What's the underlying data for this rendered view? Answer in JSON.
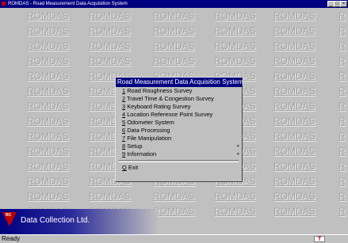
{
  "window": {
    "title": "ROMDAS - Road Measurement Data Acquisition System"
  },
  "watermark": {
    "text": "ROMDAS",
    "edge_text": "R"
  },
  "menu": {
    "title": "Road Measurement Data Acquisition System",
    "items": [
      {
        "key": "1",
        "label": "Road Roughness Survey"
      },
      {
        "key": "2",
        "label": "Travel Time & Congestion Survey"
      },
      {
        "key": "3",
        "label": "Keyboard Rating Survey"
      },
      {
        "key": "4",
        "label": "Location Reference Point Survey"
      },
      {
        "key": "5",
        "label": "Odometer System"
      },
      {
        "key": "6",
        "label": "Data Processing"
      },
      {
        "key": "7",
        "label": "File Manipulation"
      },
      {
        "key": "8",
        "label": "Setup",
        "submenu": "»"
      },
      {
        "key": "9",
        "label": "Information",
        "submenu": "»"
      }
    ],
    "exit": {
      "key": "Q",
      "label": "Exit"
    }
  },
  "logo": {
    "badge": "RC",
    "text": "Data Collection Ltd."
  },
  "status": {
    "text": "Ready",
    "indicator": "T"
  },
  "colors": {
    "titlebar": "#000080",
    "background": "#c0c0c0",
    "watermark": "#a7a7a7",
    "logo_red": "#c00000"
  }
}
